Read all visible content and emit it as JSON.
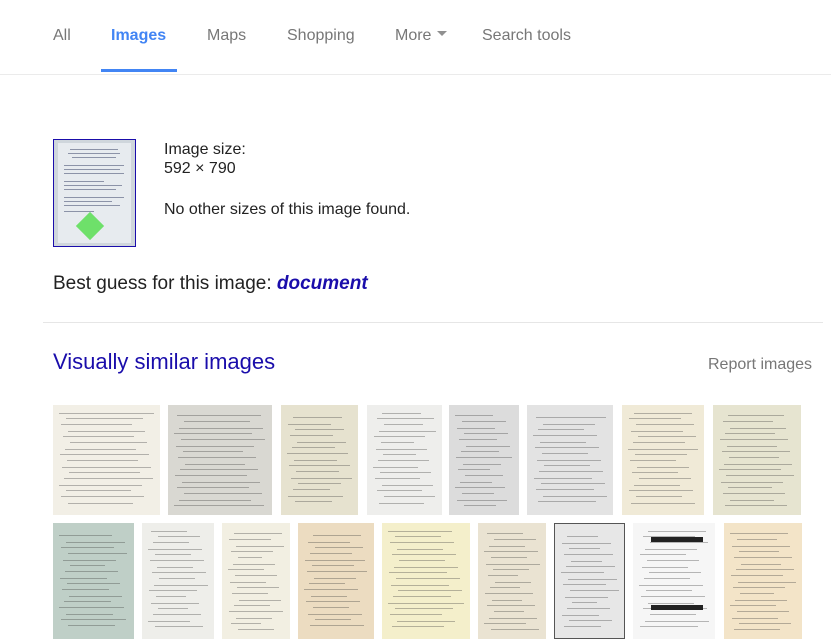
{
  "tabs": {
    "all": "All",
    "images": "Images",
    "maps": "Maps",
    "shopping": "Shopping",
    "more": "More",
    "search_tools": "Search tools",
    "active": "Images",
    "accent_color": "#4285f4"
  },
  "result": {
    "image_size_label": "Image size:",
    "image_size_value": "592 × 790",
    "no_other_sizes": "No other sizes of this image found.",
    "best_guess_prefix": "Best guess for this image:",
    "best_guess_term": "document"
  },
  "similar": {
    "title": "Visually similar images",
    "report_label": "Report images",
    "link_color": "#1a0dab",
    "row1_count": 8,
    "row2_count": 9
  }
}
